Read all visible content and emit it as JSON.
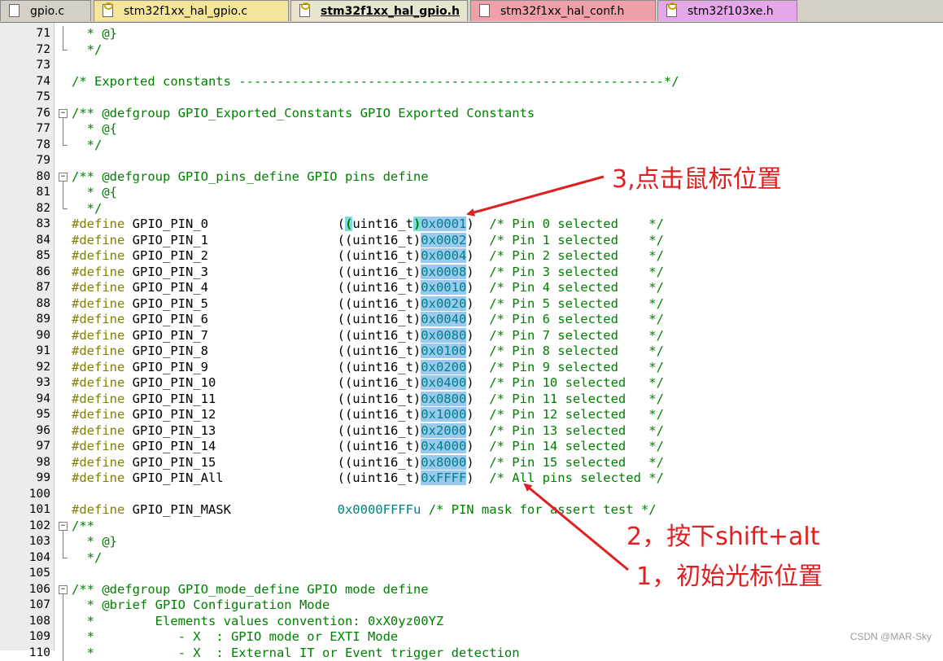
{
  "tabs": [
    {
      "label": "gpio.c",
      "icon": "file-icon",
      "bg": "#d4d0c8"
    },
    {
      "label": "stm32f1xx_hal_gpio.c",
      "icon": "key-file-icon",
      "bg": "#f4e59a"
    },
    {
      "label": "stm32f1xx_hal_gpio.h",
      "icon": "key-file-icon",
      "bg": "#e8e4d0",
      "active": true
    },
    {
      "label": "stm32f1xx_hal_conf.h",
      "icon": "file-icon",
      "bg": "#f0a0a8"
    },
    {
      "label": "stm32f103xe.h",
      "icon": "key-file-icon",
      "bg": "#e6a6ea"
    }
  ],
  "lines": [
    {
      "n": "71",
      "fold": "line",
      "segs": [
        {
          "t": "  * @}",
          "c": "cm"
        }
      ]
    },
    {
      "n": "72",
      "fold": "end",
      "segs": [
        {
          "t": "  */",
          "c": "cm"
        }
      ]
    },
    {
      "n": "73",
      "fold": "",
      "segs": []
    },
    {
      "n": "74",
      "fold": "",
      "segs": [
        {
          "t": "/* Exported constants --------------------------------------------------------*/",
          "c": "cm"
        }
      ]
    },
    {
      "n": "75",
      "fold": "",
      "segs": []
    },
    {
      "n": "76",
      "fold": "box",
      "segs": [
        {
          "t": "/** @defgroup GPIO_Exported_Constants GPIO Exported Constants",
          "c": "cm"
        }
      ]
    },
    {
      "n": "77",
      "fold": "line",
      "segs": [
        {
          "t": "  * @{",
          "c": "cm"
        }
      ]
    },
    {
      "n": "78",
      "fold": "end",
      "segs": [
        {
          "t": "  */",
          "c": "cm"
        }
      ]
    },
    {
      "n": "79",
      "fold": "",
      "segs": []
    },
    {
      "n": "80",
      "fold": "box",
      "segs": [
        {
          "t": "/** @defgroup GPIO_pins_define GPIO pins define",
          "c": "cm"
        }
      ]
    },
    {
      "n": "81",
      "fold": "line",
      "segs": [
        {
          "t": "  * @{",
          "c": "cm"
        }
      ]
    },
    {
      "n": "82",
      "fold": "end",
      "segs": [
        {
          "t": "  */",
          "c": "cm"
        }
      ]
    },
    {
      "n": "83",
      "fold": "",
      "segs": [
        {
          "t": "#define",
          "c": "pp"
        },
        {
          "t": " GPIO_PIN_0                 ",
          "c": "id"
        },
        {
          "t": "(",
          "c": "id"
        },
        {
          "t": "(",
          "c": "brc"
        },
        {
          "t": "uint16_t",
          "c": "id"
        },
        {
          "t": ")",
          "c": "brc"
        },
        {
          "t": "0x0001",
          "c": "num hl"
        },
        {
          "t": ")  ",
          "c": "id"
        },
        {
          "t": "/* Pin 0 selected    */",
          "c": "cm"
        }
      ]
    },
    {
      "n": "84",
      "fold": "",
      "segs": [
        {
          "t": "#define",
          "c": "pp"
        },
        {
          "t": " GPIO_PIN_1                 ((uint16_t)",
          "c": "id"
        },
        {
          "t": "0x0002",
          "c": "num hl"
        },
        {
          "t": ")  ",
          "c": "id"
        },
        {
          "t": "/* Pin 1 selected    */",
          "c": "cm"
        }
      ]
    },
    {
      "n": "85",
      "fold": "",
      "segs": [
        {
          "t": "#define",
          "c": "pp"
        },
        {
          "t": " GPIO_PIN_2                 ((uint16_t)",
          "c": "id"
        },
        {
          "t": "0x0004",
          "c": "num hl"
        },
        {
          "t": ")  ",
          "c": "id"
        },
        {
          "t": "/* Pin 2 selected    */",
          "c": "cm"
        }
      ]
    },
    {
      "n": "86",
      "fold": "",
      "segs": [
        {
          "t": "#define",
          "c": "pp"
        },
        {
          "t": " GPIO_PIN_3                 ((uint16_t)",
          "c": "id"
        },
        {
          "t": "0x0008",
          "c": "num hl"
        },
        {
          "t": ")  ",
          "c": "id"
        },
        {
          "t": "/* Pin 3 selected    */",
          "c": "cm"
        }
      ]
    },
    {
      "n": "87",
      "fold": "",
      "segs": [
        {
          "t": "#define",
          "c": "pp"
        },
        {
          "t": " GPIO_PIN_4                 ((uint16_t)",
          "c": "id"
        },
        {
          "t": "0x0010",
          "c": "num hl"
        },
        {
          "t": ")  ",
          "c": "id"
        },
        {
          "t": "/* Pin 4 selected    */",
          "c": "cm"
        }
      ]
    },
    {
      "n": "88",
      "fold": "",
      "segs": [
        {
          "t": "#define",
          "c": "pp"
        },
        {
          "t": " GPIO_PIN_5                 ((uint16_t)",
          "c": "id"
        },
        {
          "t": "0x0020",
          "c": "num hl"
        },
        {
          "t": ")  ",
          "c": "id"
        },
        {
          "t": "/* Pin 5 selected    */",
          "c": "cm"
        }
      ]
    },
    {
      "n": "89",
      "fold": "",
      "segs": [
        {
          "t": "#define",
          "c": "pp"
        },
        {
          "t": " GPIO_PIN_6                 ((uint16_t)",
          "c": "id"
        },
        {
          "t": "0x0040",
          "c": "num hl"
        },
        {
          "t": ")  ",
          "c": "id"
        },
        {
          "t": "/* Pin 6 selected    */",
          "c": "cm"
        }
      ]
    },
    {
      "n": "90",
      "fold": "",
      "segs": [
        {
          "t": "#define",
          "c": "pp"
        },
        {
          "t": " GPIO_PIN_7                 ((uint16_t)",
          "c": "id"
        },
        {
          "t": "0x0080",
          "c": "num hl"
        },
        {
          "t": ")  ",
          "c": "id"
        },
        {
          "t": "/* Pin 7 selected    */",
          "c": "cm"
        }
      ]
    },
    {
      "n": "91",
      "fold": "",
      "segs": [
        {
          "t": "#define",
          "c": "pp"
        },
        {
          "t": " GPIO_PIN_8                 ((uint16_t)",
          "c": "id"
        },
        {
          "t": "0x0100",
          "c": "num hl"
        },
        {
          "t": ")  ",
          "c": "id"
        },
        {
          "t": "/* Pin 8 selected    */",
          "c": "cm"
        }
      ]
    },
    {
      "n": "92",
      "fold": "",
      "segs": [
        {
          "t": "#define",
          "c": "pp"
        },
        {
          "t": " GPIO_PIN_9                 ((uint16_t)",
          "c": "id"
        },
        {
          "t": "0x0200",
          "c": "num hl"
        },
        {
          "t": ")  ",
          "c": "id"
        },
        {
          "t": "/* Pin 9 selected    */",
          "c": "cm"
        }
      ]
    },
    {
      "n": "93",
      "fold": "",
      "segs": [
        {
          "t": "#define",
          "c": "pp"
        },
        {
          "t": " GPIO_PIN_10                ((uint16_t)",
          "c": "id"
        },
        {
          "t": "0x0400",
          "c": "num hl"
        },
        {
          "t": ")  ",
          "c": "id"
        },
        {
          "t": "/* Pin 10 selected   */",
          "c": "cm"
        }
      ]
    },
    {
      "n": "94",
      "fold": "",
      "segs": [
        {
          "t": "#define",
          "c": "pp"
        },
        {
          "t": " GPIO_PIN_11                ((uint16_t)",
          "c": "id"
        },
        {
          "t": "0x0800",
          "c": "num hl"
        },
        {
          "t": ")  ",
          "c": "id"
        },
        {
          "t": "/* Pin 11 selected   */",
          "c": "cm"
        }
      ]
    },
    {
      "n": "95",
      "fold": "",
      "segs": [
        {
          "t": "#define",
          "c": "pp"
        },
        {
          "t": " GPIO_PIN_12                ((uint16_t)",
          "c": "id"
        },
        {
          "t": "0x1000",
          "c": "num hl"
        },
        {
          "t": ")  ",
          "c": "id"
        },
        {
          "t": "/* Pin 12 selected   */",
          "c": "cm"
        }
      ]
    },
    {
      "n": "96",
      "fold": "",
      "segs": [
        {
          "t": "#define",
          "c": "pp"
        },
        {
          "t": " GPIO_PIN_13                ((uint16_t)",
          "c": "id"
        },
        {
          "t": "0x2000",
          "c": "num hl"
        },
        {
          "t": ")  ",
          "c": "id"
        },
        {
          "t": "/* Pin 13 selected   */",
          "c": "cm"
        }
      ]
    },
    {
      "n": "97",
      "fold": "",
      "segs": [
        {
          "t": "#define",
          "c": "pp"
        },
        {
          "t": " GPIO_PIN_14                ((uint16_t)",
          "c": "id"
        },
        {
          "t": "0x4000",
          "c": "num hl"
        },
        {
          "t": ")  ",
          "c": "id"
        },
        {
          "t": "/* Pin 14 selected   */",
          "c": "cm"
        }
      ]
    },
    {
      "n": "98",
      "fold": "",
      "segs": [
        {
          "t": "#define",
          "c": "pp"
        },
        {
          "t": " GPIO_PIN_15                ((uint16_t)",
          "c": "id"
        },
        {
          "t": "0x8000",
          "c": "num hl"
        },
        {
          "t": ")  ",
          "c": "id"
        },
        {
          "t": "/* Pin 15 selected   */",
          "c": "cm"
        }
      ]
    },
    {
      "n": "99",
      "fold": "",
      "segs": [
        {
          "t": "#define",
          "c": "pp"
        },
        {
          "t": " GPIO_PIN_All               ((uint16_t)",
          "c": "id"
        },
        {
          "t": "0xFFFF",
          "c": "num hl"
        },
        {
          "t": ")  ",
          "c": "id"
        },
        {
          "t": "/* All pins selected */",
          "c": "cm"
        }
      ]
    },
    {
      "n": "100",
      "fold": "",
      "segs": []
    },
    {
      "n": "101",
      "fold": "",
      "segs": [
        {
          "t": "#define",
          "c": "pp"
        },
        {
          "t": " GPIO_PIN_MASK              ",
          "c": "id"
        },
        {
          "t": "0x0000FFFFu",
          "c": "num"
        },
        {
          "t": " /* PIN mask for assert test */",
          "c": "cm"
        }
      ]
    },
    {
      "n": "102",
      "fold": "box",
      "segs": [
        {
          "t": "/**",
          "c": "cm"
        }
      ]
    },
    {
      "n": "103",
      "fold": "line",
      "segs": [
        {
          "t": "  * @}",
          "c": "cm"
        }
      ]
    },
    {
      "n": "104",
      "fold": "end",
      "segs": [
        {
          "t": "  */",
          "c": "cm"
        }
      ]
    },
    {
      "n": "105",
      "fold": "",
      "segs": []
    },
    {
      "n": "106",
      "fold": "box",
      "segs": [
        {
          "t": "/** @defgroup GPIO_mode_define GPIO mode define",
          "c": "cm"
        }
      ]
    },
    {
      "n": "107",
      "fold": "line",
      "segs": [
        {
          "t": "  * @brief GPIO Configuration Mode",
          "c": "cm"
        }
      ]
    },
    {
      "n": "108",
      "fold": "line",
      "segs": [
        {
          "t": "  *        Elements values convention: 0xX0yz00YZ",
          "c": "cm"
        }
      ]
    },
    {
      "n": "109",
      "fold": "line",
      "segs": [
        {
          "t": "  *           - X  : GPIO mode or EXTI Mode",
          "c": "cm"
        }
      ]
    },
    {
      "n": "110",
      "fold": "line",
      "segs": [
        {
          "t": "  *           - X  : External IT or Event trigger detection",
          "c": "cm"
        }
      ]
    }
  ],
  "annotations": {
    "a3": "3,点击鼠标位置",
    "a2": "2，按下shift+alt",
    "a1": "1，初始光标位置"
  },
  "colors": {
    "annotation": "#e02020",
    "selection": "#99c9f1",
    "brace_match": "#7fdbe0"
  },
  "watermark": "CSDN @MAR-Sky"
}
